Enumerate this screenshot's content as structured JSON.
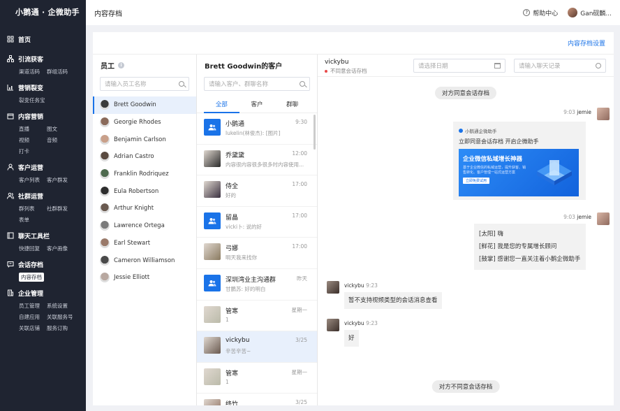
{
  "brand": "小鹅通 · 企微助手",
  "topbar": {
    "title": "内容存档",
    "help": "帮助中心",
    "user": "Gan砚麟..."
  },
  "nav": [
    {
      "icon": "home-icon",
      "title": "首页",
      "items": []
    },
    {
      "icon": "network-icon",
      "title": "引流获客",
      "items": [
        "渠道活码",
        "群组活码"
      ]
    },
    {
      "icon": "chart-icon",
      "title": "营销裂变",
      "items": [
        "裂变任务宝"
      ]
    },
    {
      "icon": "box-icon",
      "title": "内容营销",
      "items": [
        "直播",
        "图文",
        "视频",
        "音频",
        "打卡"
      ]
    },
    {
      "icon": "person-icon",
      "title": "客户运营",
      "items": [
        "客户列表",
        "客户群发"
      ]
    },
    {
      "icon": "people-icon",
      "title": "社群运营",
      "items": [
        "群列表",
        "社群群发",
        "表单"
      ]
    },
    {
      "icon": "toolbar-icon",
      "title": "聊天工具栏",
      "items": [
        "快捷回复",
        "客户画像"
      ]
    },
    {
      "icon": "archive-icon",
      "title": "会话存档",
      "items": [
        "内容存档"
      ]
    },
    {
      "icon": "building-icon",
      "title": "企业管理",
      "items": [
        "员工管理",
        "系统设置",
        "自建应用",
        "关联服务号",
        "关联店铺",
        "服务订购"
      ]
    }
  ],
  "settings_link": "内容存档设置",
  "employees": {
    "title": "员工",
    "search_placeholder": "请输入员工名称",
    "list": [
      "Brett Goodwin",
      "Georgie Rhodes",
      "Benjamin Carlson",
      "Adrian Castro",
      "Franklin Rodriquez",
      "Eula Robertson",
      "Arthur Knight",
      "Lawrence Ortega",
      "Earl Stewart",
      "Cameron Williamson",
      "Jessie Elliott"
    ]
  },
  "customers": {
    "title": "Brett Goodwin的客户",
    "search_placeholder": "请输入客户、群聊名称",
    "tabs": [
      "全部",
      "客户",
      "群聊"
    ],
    "list": [
      {
        "name": "小鹅通",
        "preview": "lukelin(林俊杰): [图片]",
        "time": "9:30",
        "group": true
      },
      {
        "name": "乔黛黛",
        "preview": "内容很内容很多很多时内容使用...",
        "time": "12:00",
        "group": false
      },
      {
        "name": "侍全",
        "preview": "好的",
        "time": "17:00",
        "group": false
      },
      {
        "name": "留晶",
        "preview": "vicki卜: 说的好",
        "time": "17:00",
        "group": true
      },
      {
        "name": "弓娜",
        "preview": "明天我来找你",
        "time": "17:00",
        "group": false
      },
      {
        "name": "深圳湾业主沟通群",
        "preview": "甘鹏苏: 好的明白",
        "time": "昨天",
        "group": true
      },
      {
        "name": "管寒",
        "preview": "1",
        "time": "星期一",
        "group": false
      },
      {
        "name": "vickybu",
        "preview": "辛苦辛苦~",
        "time": "3/25",
        "group": false
      },
      {
        "name": "管寒",
        "preview": "1",
        "time": "星期一",
        "group": false
      },
      {
        "name": "终竹",
        "preview": "",
        "time": "3/25",
        "group": false
      }
    ]
  },
  "chat": {
    "user": "vickybu",
    "status": "不同意会话存档",
    "date_placeholder": "请选择日期",
    "search_placeholder": "请输入聊天记录",
    "sys_agree": "对方同意会话存档",
    "sys_disagree": "对方不同意会话存档",
    "card_meta_time": "9:03",
    "card_meta_name": "jemie",
    "card_brand": "小鹅通企微助手",
    "card_title": "立即同意会话存档 开启企微助手",
    "card_banner": "企业微信私域增长神器",
    "card_banner_sub": "基于企业微信的私域运营，提升获客、销售转化、客户管理一站式运营方案",
    "card_banner_btn": "立即免费试用",
    "msg2_time": "9:03",
    "msg2_name": "jemie",
    "msg2_lines": [
      "[太阳] 嗨",
      "[鲜花] 我是您的专属增长顾问",
      "[鼓掌] 感谢您一直关注着小鹅企微助手"
    ],
    "msg3_name": "vickybu",
    "msg3_time": "9:23",
    "msg3_text": "暂不支持视频类型的会话消息查看",
    "msg4_name": "vickybu",
    "msg4_time": "9:23",
    "msg4_text": "好"
  },
  "colors": {
    "accent": "#1a73e8",
    "sidebar": "#1f2431"
  }
}
